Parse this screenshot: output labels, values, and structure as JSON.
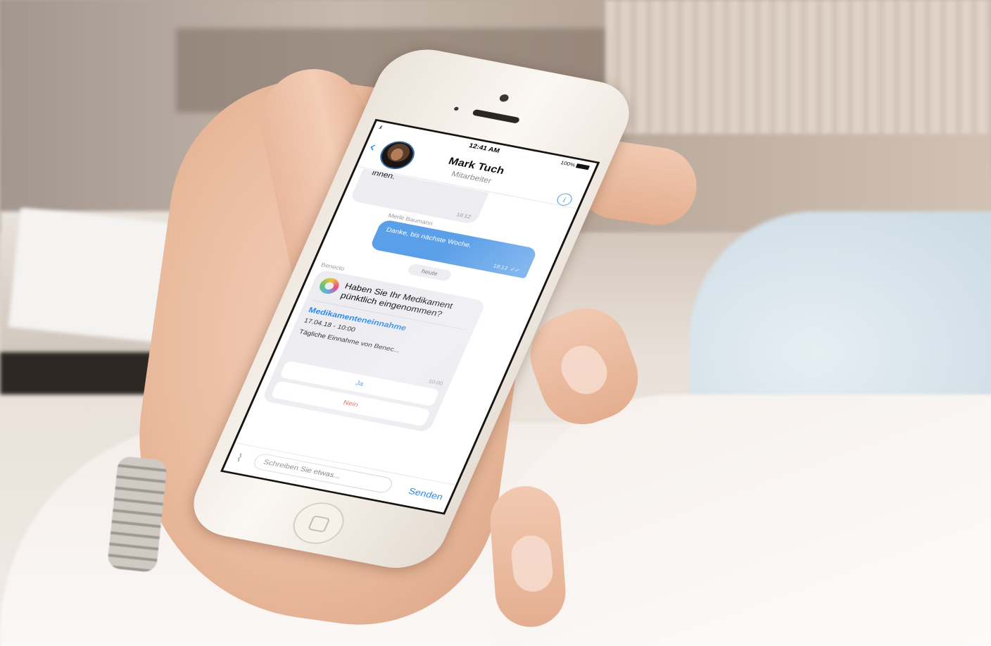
{
  "status_bar": {
    "signal": ".ıl",
    "time": "12:41 AM",
    "battery": "100%"
  },
  "header": {
    "back_icon": "chevron-left-icon",
    "contact_name": "Mark Tuch",
    "contact_role": "Mitarbeiter",
    "info_icon": "info-icon",
    "info_glyph": "i"
  },
  "messages": {
    "partial_incoming": {
      "text": "innen.",
      "time": "18:12"
    },
    "outgoing": {
      "sender": "Merle Baumann",
      "text": "Danke, bis nächste Woche.",
      "time": "18:13",
      "read_icon": "double-check-icon",
      "read_glyph": "✓✓"
    },
    "date_separator": "heute",
    "bot": {
      "sender": "Benecto",
      "question": "Haben Sie Ihr Medikament pünktlich eingenommen?",
      "link_title": "Medikamenteneinnahme",
      "datetime": "17.04.18 - 10:00",
      "description": "Tägliche Einnahme von Benec...",
      "time": "10:00",
      "options": {
        "yes": "Ja",
        "no": "Nein"
      }
    }
  },
  "composer": {
    "attach_icon": "paperclip-icon",
    "attach_glyph": "⌇",
    "placeholder": "Schreiben Sie etwas...",
    "send_label": "Senden"
  },
  "colors": {
    "accent": "#2f8be8",
    "outgoing_bubble": "#5b9fe8",
    "incoming_bubble": "#ececf1",
    "destructive": "#e2453c"
  }
}
